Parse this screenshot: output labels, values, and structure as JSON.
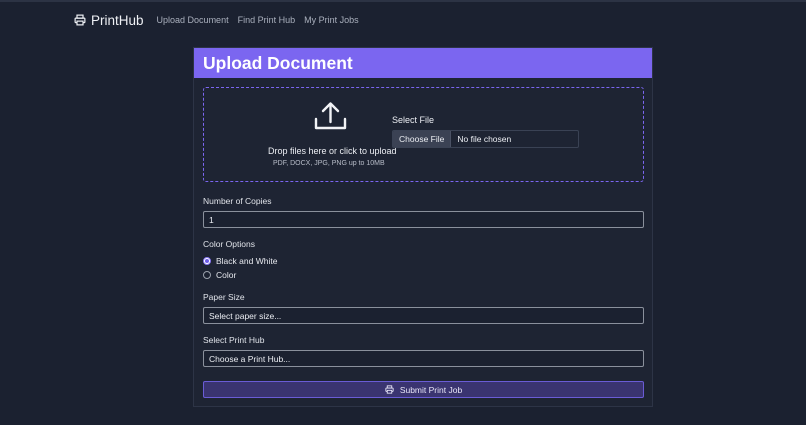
{
  "nav": {
    "brand": "PrintHub",
    "brand_icon": "printer-icon",
    "links": [
      "Upload Document",
      "Find Print Hub",
      "My Print Jobs"
    ]
  },
  "card": {
    "title": "Upload Document",
    "dropzone": {
      "icon": "upload-icon",
      "text": "Drop files here or click to upload",
      "subtext": "PDF, DOCX, JPG, PNG up to 10MB",
      "file_label": "Select File",
      "choose_button": "Choose File",
      "file_status": "No file chosen"
    },
    "copies": {
      "label": "Number of Copies",
      "value": "1"
    },
    "color": {
      "label": "Color Options",
      "options": [
        "Black and White",
        "Color"
      ],
      "selected": "Black and White"
    },
    "paper": {
      "label": "Paper Size",
      "placeholder": "Select paper size..."
    },
    "hub": {
      "label": "Select Print Hub",
      "placeholder": "Choose a Print Hub..."
    },
    "submit": {
      "label": "Submit Print Job",
      "icon": "printer-icon"
    }
  },
  "colors": {
    "accent": "#7b66f0",
    "background": "#1b2130",
    "card": "#1e2433",
    "submit_bg": "#3a3470"
  }
}
